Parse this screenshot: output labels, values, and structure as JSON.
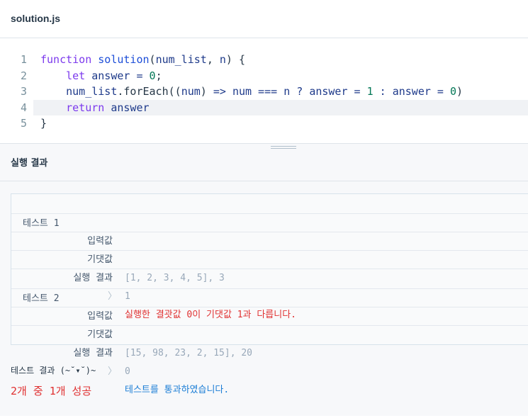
{
  "file": {
    "name": "solution.js"
  },
  "editor": {
    "active_line": 4,
    "lines": [
      {
        "number": "1",
        "tokens": [
          {
            "t": "function",
            "k": "kw"
          },
          {
            "t": " ",
            "k": "pl"
          },
          {
            "t": "solution",
            "k": "fn"
          },
          {
            "t": "(",
            "k": "pl"
          },
          {
            "t": "num_list",
            "k": "id"
          },
          {
            "t": ", ",
            "k": "pl"
          },
          {
            "t": "n",
            "k": "id"
          },
          {
            "t": ") {",
            "k": "pl"
          }
        ]
      },
      {
        "number": "2",
        "tokens": [
          {
            "t": "    ",
            "k": "pl"
          },
          {
            "t": "let",
            "k": "kw"
          },
          {
            "t": " ",
            "k": "pl"
          },
          {
            "t": "answer",
            "k": "id"
          },
          {
            "t": " = ",
            "k": "op"
          },
          {
            "t": "0",
            "k": "nm"
          },
          {
            "t": ";",
            "k": "pl"
          }
        ]
      },
      {
        "number": "3",
        "tokens": [
          {
            "t": "    ",
            "k": "pl"
          },
          {
            "t": "num_list",
            "k": "id"
          },
          {
            "t": ".",
            "k": "pl"
          },
          {
            "t": "forEach",
            "k": "pl"
          },
          {
            "t": "((",
            "k": "pl"
          },
          {
            "t": "num",
            "k": "id"
          },
          {
            "t": ") ",
            "k": "pl"
          },
          {
            "t": "=>",
            "k": "op"
          },
          {
            "t": " ",
            "k": "pl"
          },
          {
            "t": "num",
            "k": "id"
          },
          {
            "t": " === ",
            "k": "op"
          },
          {
            "t": "n",
            "k": "id"
          },
          {
            "t": " ? ",
            "k": "op"
          },
          {
            "t": "answer",
            "k": "id"
          },
          {
            "t": " = ",
            "k": "op"
          },
          {
            "t": "1",
            "k": "nm"
          },
          {
            "t": " : ",
            "k": "op"
          },
          {
            "t": "answer",
            "k": "id"
          },
          {
            "t": " = ",
            "k": "op"
          },
          {
            "t": "0",
            "k": "nm"
          },
          {
            "t": ")",
            "k": "pl"
          }
        ]
      },
      {
        "number": "4",
        "tokens": [
          {
            "t": "    ",
            "k": "pl"
          },
          {
            "t": "return",
            "k": "kw"
          },
          {
            "t": " ",
            "k": "pl"
          },
          {
            "t": "answer",
            "k": "id"
          }
        ]
      },
      {
        "number": "5",
        "tokens": [
          {
            "t": "}",
            "k": "pl"
          }
        ]
      }
    ]
  },
  "results": {
    "title": "실행 결과",
    "tests": [
      {
        "name": "테스트 1",
        "input_label": "입력값",
        "input_value": "[1, 2, 3, 4, 5], 3",
        "expected_label": "기댓값",
        "expected_value": "1",
        "result_label": "실행 결과",
        "result_value": "실행한 결괏값 0이 기댓값 1과 다릅니다.",
        "passed": false
      },
      {
        "name": "테스트 2",
        "input_label": "입력값",
        "input_value": "[15, 98, 23, 2, 15], 20",
        "expected_label": "기댓값",
        "expected_value": "0",
        "result_label": "실행 결과",
        "result_value": "테스트를 통과하였습니다.",
        "passed": true
      }
    ],
    "separator": "〉",
    "summary_label": "테스트 결과 (~˘▾˘)~",
    "summary_value": "2개 중 1개 성공"
  },
  "colors": {
    "fail": "#e03131",
    "pass": "#1c7ed6",
    "keyword": "#7c3aed",
    "function_name": "#1d4ed8",
    "number": "#047857"
  }
}
